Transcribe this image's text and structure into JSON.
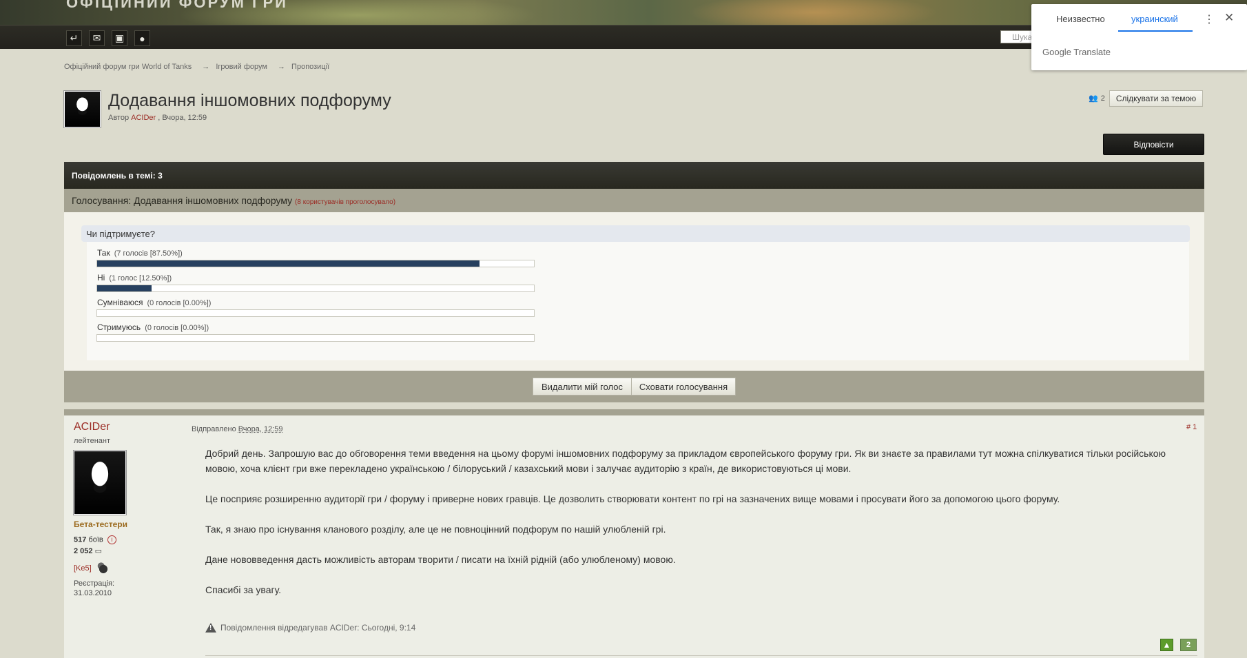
{
  "header": {
    "banner_title": "ОФІЦІЙНИЙ ФОРУМ ГРИ",
    "search_placeholder": "Шука"
  },
  "translate": {
    "tab_unknown": "Неизвестно",
    "tab_ukrainian": "украинский",
    "menu_icon": "⋮",
    "close_icon": "✕",
    "logo": "Google Translate"
  },
  "breadcrumbs": [
    "Офіційний форум гри World of Tanks",
    "Ігровий форум",
    "Пропозиції"
  ],
  "breadcrumb_sep": "→",
  "topic": {
    "title": "Додавання іншомовних подфоруму",
    "meta_prefix": "Автор",
    "author": "ACIDer",
    "meta_date": ", Вчора, 12:59",
    "followers": "2",
    "follow_label": "Слідкувати за темою",
    "reply_label": "Відповісти"
  },
  "posts_count": "Повідомлень в темі: 3",
  "poll": {
    "title": "Голосування: Додавання іншомовних подфоруму",
    "voters": "(8 користувачів проголосувало)",
    "question": "Чи підтримуєте?",
    "options": [
      {
        "label": "Так",
        "votes": "(7 голосів [87.50%])",
        "percent": 87.5
      },
      {
        "label": "Ні",
        "votes": "(1 голос [12.50%])",
        "percent": 12.5
      },
      {
        "label": "Сумніваюся",
        "votes": "(0 голосів [0.00%])",
        "percent": 0
      },
      {
        "label": "Стримуюсь",
        "votes": "(0 голосів [0.00%])",
        "percent": 0
      }
    ],
    "delete_vote": "Видалити мій голос",
    "hide_poll": "Сховати голосування"
  },
  "post": {
    "author": "ACIDer",
    "rank": "лейтенант",
    "group": "Бета-тестери",
    "battles": "517",
    "battles_label": "боїв",
    "posts": "2 052",
    "clan": "[Ke5]",
    "reg_label": "Реєстрація:",
    "reg_date": "31.03.2010",
    "sent_label": "Відправлено",
    "sent_date": "Вчора, 12:59",
    "number": "# 1",
    "paragraphs": [
      "Добрий день. Запрошую вас до обговорення теми введення на цьому форумі іншомовних подфоруму за прикладом європейського форуму гри. Як ви знаєте за правилами тут можна спілкуватися тільки російською мовою, хоча клієнт гри вже перекладено українською / білоруський / казахський мови і залучає аудиторію з країн, де використовуються ці мови.",
      "Це посприяє розширенню аудиторії гри / форуму і приверне нових гравців. Це дозволить створювати контент по грі на зазначених вище мовами і просувати його за допомогою цього форуму.",
      "Так, я знаю про існування кланового розділу, але це не повноцінний подфорум по нашій улюбленій грі.",
      "Дане нововведення дасть можливість авторам творити / писати на їхній рідній (або улюбленому) мовою.",
      "Спасибі за увагу."
    ],
    "edited": "Повідомлення відредагував ACIDer: Сьогодні, 9:14",
    "reputation": "2"
  }
}
